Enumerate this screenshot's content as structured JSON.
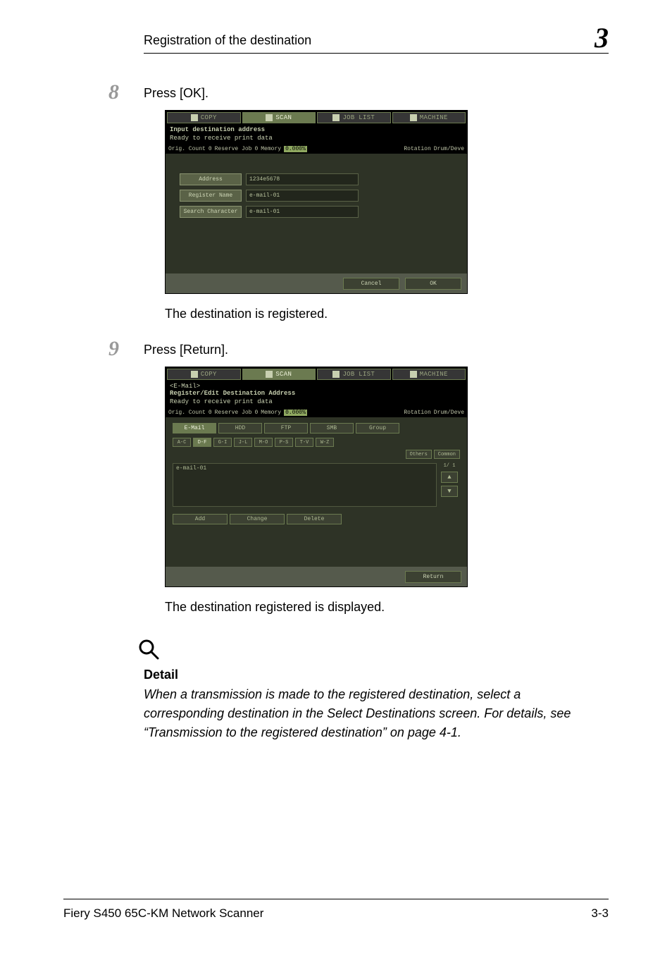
{
  "header": {
    "running_head": "Registration of the destination",
    "chapter": "3"
  },
  "steps": {
    "s8": {
      "num": "8",
      "text": "Press [OK].",
      "result": "The destination is registered."
    },
    "s9": {
      "num": "9",
      "text": "Press [Return].",
      "result": "The destination registered is displayed."
    }
  },
  "screen1": {
    "tabs": {
      "copy": "COPY",
      "scan": "SCAN",
      "joblist": "JOB LIST",
      "machine": "MACHINE"
    },
    "title": "Input destination address",
    "ready": "Ready to receive print data",
    "status": {
      "orig": "Orig. Count",
      "orig_val": "0",
      "res": "Reserve Job",
      "res_val": "0",
      "mem": "Memory",
      "mem_val": "0.000%",
      "rot": "Rotation",
      "drum": "Drum/Deve"
    },
    "form": {
      "address_label": "Address",
      "address_val": "1234e5678",
      "regname_label": "Register Name",
      "regname_val": "e-mail-01",
      "search_label": "Search Character",
      "search_val": "e-mail-01"
    },
    "footer": {
      "cancel": "Cancel",
      "ok": "OK"
    }
  },
  "screen2": {
    "tabs": {
      "copy": "COPY",
      "scan": "SCAN",
      "joblist": "JOB LIST",
      "machine": "MACHINE"
    },
    "crumb": "<E-Mail>",
    "title": "Register/Edit Destination Address",
    "ready": "Ready to receive print data",
    "status": {
      "orig": "Orig. Count",
      "orig_val": "0",
      "res": "Reserve Job",
      "res_val": "0",
      "mem": "Memory",
      "mem_val": "0.000%",
      "rot": "Rotation",
      "drum": "Drum/Deve"
    },
    "dtabs": {
      "email": "E-Mail",
      "hdd": "HDD",
      "ftp": "FTP",
      "smb": "SMB",
      "group": "Group"
    },
    "alpha": {
      "ac": "A-C",
      "df": "D-F",
      "gi": "G-I",
      "jl": "J-L",
      "mo": "M-O",
      "ps": "P-S",
      "tv": "T-V",
      "wz": "W-Z",
      "others": "Others",
      "common": "Common"
    },
    "table": {
      "item1": "e-mail-01",
      "page": "1/ 1"
    },
    "actions": {
      "add": "Add",
      "change": "Change",
      "delete": "Delete"
    },
    "footer": {
      "return": "Return"
    }
  },
  "detail": {
    "heading": "Detail",
    "body": "When a transmission is made to the registered destination, select a corresponding destination in the Select Destinations screen. For details, see “Transmission to the registered destination” on page 4-1."
  },
  "footer": {
    "product": "Fiery S450 65C-KM Network Scanner",
    "page": "3-3"
  }
}
